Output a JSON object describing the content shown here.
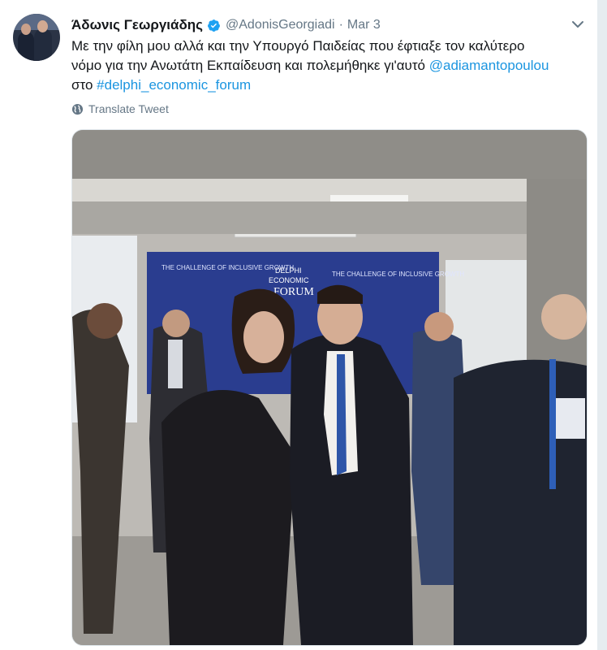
{
  "tweet": {
    "author_name": "Άδωνις Γεωργιάδης",
    "author_handle": "@AdonisGeorgiadi",
    "separator": "·",
    "date": "Mar 3",
    "text_line1": "Με την φίλη μου αλλά και την Υπουργό Παιδείας που έφτιαξε τον καλύτερο",
    "text_line2_plain": "νόμο για την Ανωτάτη Εκπαίδευση και πολεμήθηκε γι'αυτό ",
    "text_line2_mention": "@adiamantopoulou",
    "text_line3_plain": "στο ",
    "text_line3_hashtag": "#delphi_economic_forum",
    "translate_label": "Translate Tweet"
  },
  "photo": {
    "banner_left_title": "THE CHALLENGE OF INCLUSIVE GROWTH",
    "banner_right_title": "THE CHALLENGE OF INCLUSIVE GROWTH",
    "banner_logo_line1": "DELPHI",
    "banner_logo_line2": "ECONOMIC",
    "banner_logo_line3": "FORUM"
  },
  "colors": {
    "link": "#1b95e0",
    "secondary_text": "#657786",
    "verified": "#1da1f2",
    "banner_blue": "#2a3d8f"
  },
  "icons": {
    "verified": "verified-badge-icon",
    "chevron": "chevron-down-icon",
    "globe": "globe-icon"
  }
}
